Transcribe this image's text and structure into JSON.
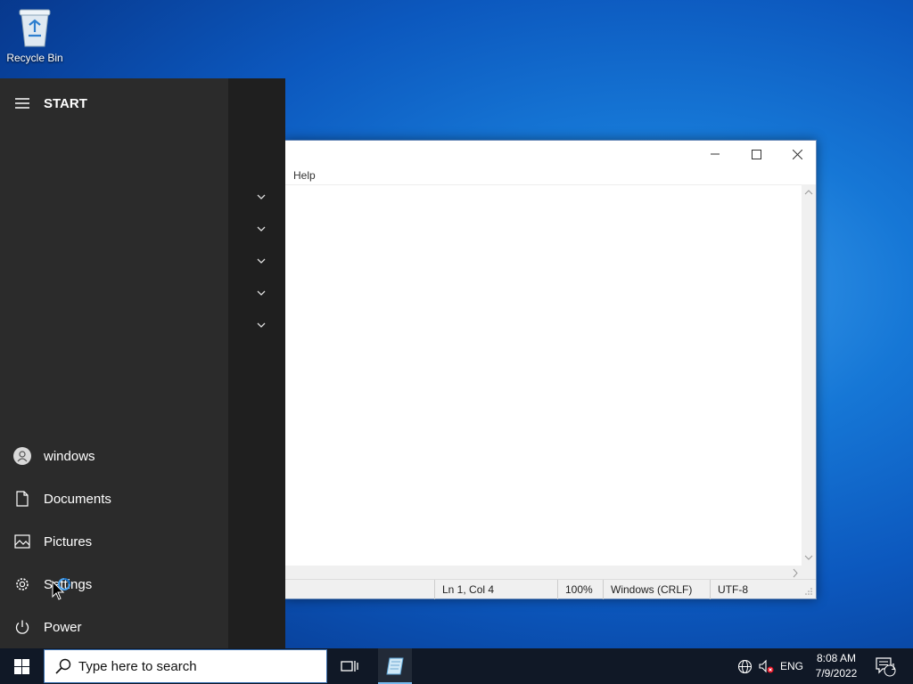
{
  "desktop": {
    "recycle_bin_label": "Recycle Bin"
  },
  "notepad": {
    "menu_help": "Help",
    "status": {
      "position": "Ln 1, Col 4",
      "zoom": "100%",
      "line_ending": "Windows (CRLF)",
      "encoding": "UTF-8"
    }
  },
  "start_menu": {
    "title": "START",
    "items": [
      {
        "label": "windows",
        "icon": "user-icon"
      },
      {
        "label": "Documents",
        "icon": "document-icon"
      },
      {
        "label": "Pictures",
        "icon": "pictures-icon"
      },
      {
        "label": "Settings",
        "icon": "gear-icon"
      },
      {
        "label": "Power",
        "icon": "power-icon"
      }
    ]
  },
  "taskbar": {
    "search_placeholder": "Type here to search",
    "language": "ENG",
    "time": "8:08 AM",
    "date": "7/9/2022",
    "notification_count": "1"
  },
  "colors": {
    "start_bg": "#2b2b2b",
    "taskbar_bg": "#101826",
    "accent": "#76b9ed"
  }
}
